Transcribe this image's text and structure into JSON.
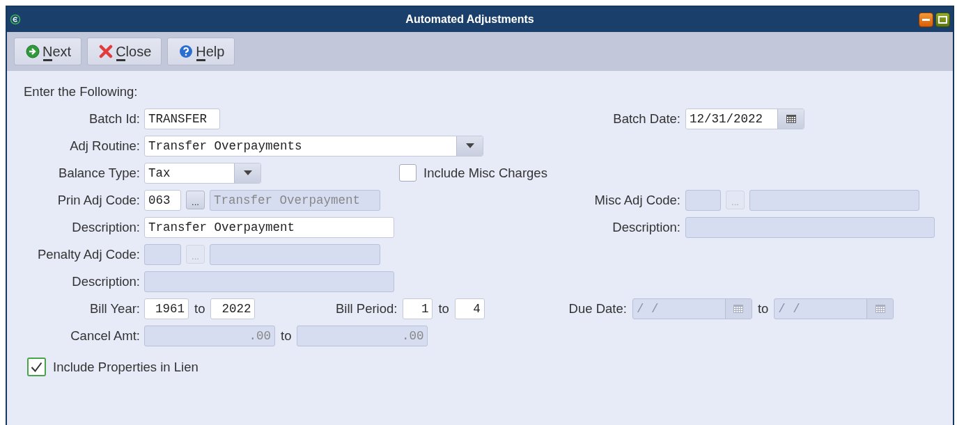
{
  "window": {
    "title": "Automated Adjustments"
  },
  "toolbar": {
    "buttons": [
      {
        "kind": "next",
        "label": "Next"
      },
      {
        "kind": "close",
        "label": "Close"
      },
      {
        "kind": "help",
        "label": "Help"
      }
    ]
  },
  "form": {
    "heading": "Enter the Following:",
    "batch_id": {
      "label": "Batch Id:",
      "value": "TRANSFER"
    },
    "batch_date": {
      "label": "Batch Date:",
      "value": "12/31/2022"
    },
    "adj_routine": {
      "label": "Adj Routine:",
      "value": "Transfer Overpayments"
    },
    "balance_type": {
      "label": "Balance Type:",
      "value": "Tax"
    },
    "include_misc_charges": {
      "label": "Include Misc Charges",
      "checked": false
    },
    "prin_adj_code": {
      "label": "Prin Adj Code:",
      "code": "063",
      "lookup": "...",
      "description": "Transfer Overpayment",
      "disabled": false
    },
    "misc_adj_code": {
      "label": "Misc Adj Code:",
      "lookup": "...",
      "disabled": true
    },
    "prin_description": {
      "label": "Description:",
      "value": "Transfer Overpayment",
      "disabled": false
    },
    "misc_description": {
      "label": "Description:",
      "disabled": true
    },
    "penalty_adj_code": {
      "label": "Penalty Adj Code:",
      "lookup": "...",
      "disabled": true
    },
    "penalty_description": {
      "label": "Description:",
      "disabled": true
    },
    "bill_year": {
      "label": "Bill Year:",
      "from": "1961",
      "to_label": "to",
      "to": "2022"
    },
    "bill_period": {
      "label": "Bill Period:",
      "from": "1",
      "to_label": "to",
      "to": "4"
    },
    "due_date": {
      "label": "Due Date:",
      "from": "/  /",
      "to_label": "to",
      "to": "/  /",
      "disabled": true
    },
    "cancel_amt": {
      "label": "Cancel Amt:",
      "from": ".00",
      "to_label": "to",
      "to": ".00",
      "disabled": true
    },
    "include_properties_in_lien": {
      "label": "Include Properties in Lien",
      "checked": true
    }
  }
}
